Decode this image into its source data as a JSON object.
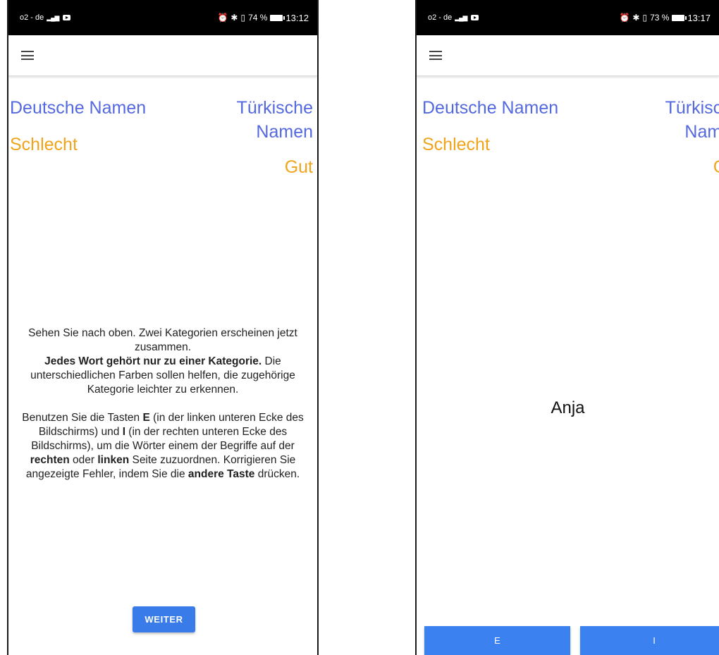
{
  "left_screen": {
    "status": {
      "carrier": "o2 - de",
      "network": "4G",
      "right_text": "74 %",
      "time": "13:12"
    },
    "categories": {
      "left_primary": "Deutsche Namen",
      "left_secondary": "Schlecht",
      "right_primary_line1": "Türkische",
      "right_primary_line2": "Namen",
      "right_secondary": "Gut"
    },
    "instructions": {
      "p1_a": "Sehen Sie nach oben. Zwei Kategorien erscheinen jetzt zusammen.",
      "p1_bold": "Jedes Wort gehört nur zu einer Kategorie.",
      "p1_b": " Die unterschiedlichen Farben sollen helfen, die zugehörige Kategorie leichter zu erkennen.",
      "p2_a": "Benutzen Sie die Tasten ",
      "p2_key_e": "E",
      "p2_b": " (in der linken unteren Ecke des Bildschirms) und ",
      "p2_key_i": "I",
      "p2_c": " (in der rechten unteren Ecke des Bildschirms), um die Wörter einem der Begriffe auf der ",
      "p2_rechten": "rechten",
      "p2_d": " oder ",
      "p2_linken": "linken",
      "p2_e": " Seite zuzuordnen. Korrigieren Sie angezeigte Fehler, indem Sie die ",
      "p2_andere": "andere Taste",
      "p2_f": " drücken."
    },
    "weiter_label": "WEITER"
  },
  "right_screen": {
    "status": {
      "carrier": "o2 - de",
      "network": "4G",
      "right_text": "73 %",
      "time": "13:17"
    },
    "categories": {
      "left_primary": "Deutsche Namen",
      "left_secondary": "Schlecht",
      "right_primary_line1": "Türkische",
      "right_primary_line2": "Namen",
      "right_secondary": "Gut"
    },
    "stimulus": "Anja",
    "key_e_label": "E",
    "key_i_label": "I"
  },
  "colors": {
    "category_blue": "#5468e0",
    "category_orange": "#f0a41b",
    "button_blue": "#3a7bea"
  }
}
